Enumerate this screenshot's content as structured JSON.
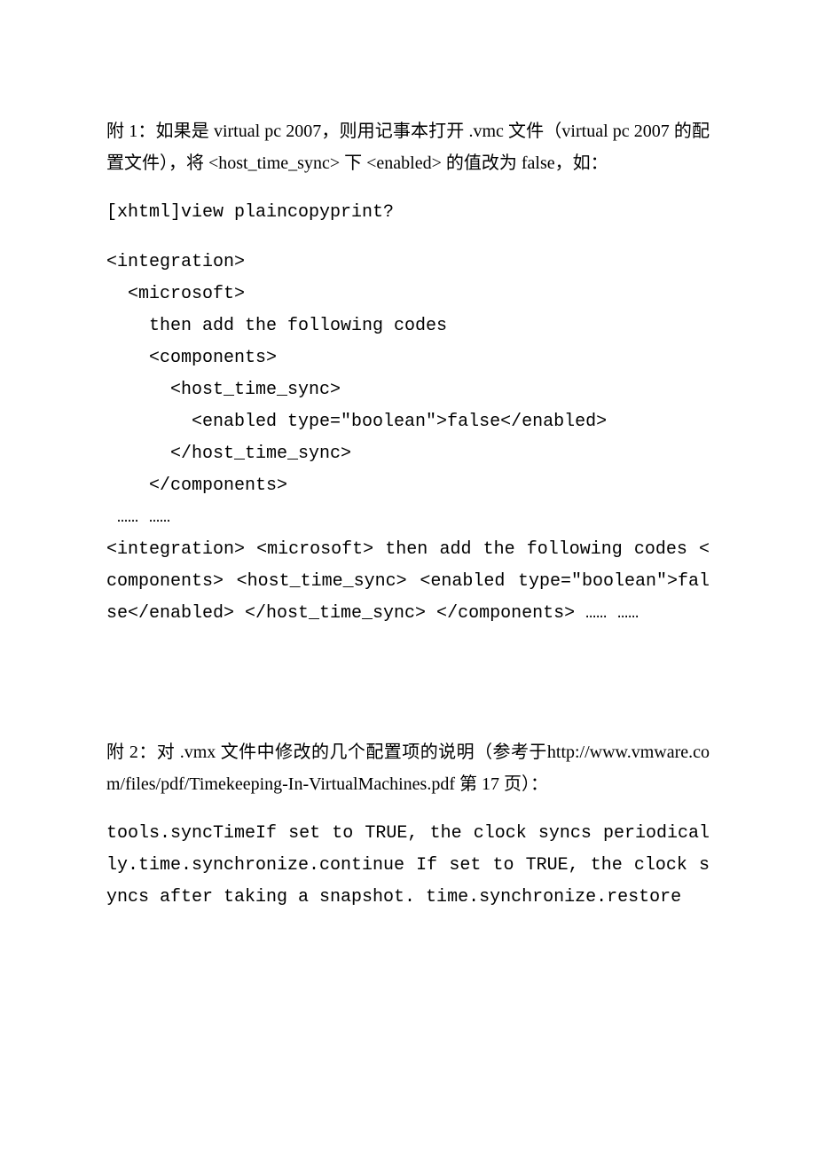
{
  "p1": "附 1：如果是 virtual pc 2007，则用记事本打开 .vmc 文件（virtual pc 2007 的配置文件），将 <host_time_sync> 下 <enabled> 的值改为 false，如：",
  "p2": "[xhtml]view plaincopyprint?",
  "code": [
    "<integration>",
    "  <microsoft>",
    "    then add the following codes",
    "    <components>",
    "      <host_time_sync>",
    "        <enabled type=\"boolean\">false</enabled>",
    "      </host_time_sync>",
    "    </components>",
    " …… ……"
  ],
  "p3": "<integration> <microsoft> then add the following codes <components> <host_time_sync> <enabled type=\"boolean\">false</enabled> </host_time_sync> </components> …… ……",
  "p4": "附 2：对 .vmx 文件中修改的几个配置项的说明（参考于http://www.vmware.com/files/pdf/Timekeeping-In-VirtualMachines.pdf 第 17 页）：",
  "p5": "tools.syncTimeIf set to TRUE, the clock syncs periodically.time.synchronize.continue If set to TRUE, the clock syncs after taking a snapshot. time.synchronize.restore"
}
